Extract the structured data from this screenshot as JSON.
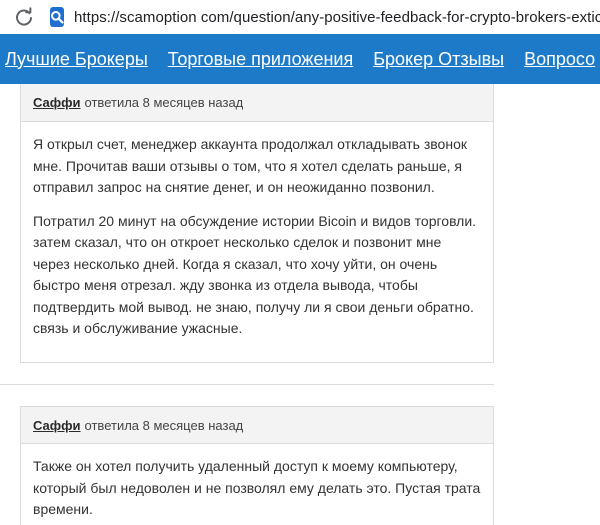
{
  "browser": {
    "url": "https://scamoption com/question/any-positive-feedback-for-crypto-brokers-extick/"
  },
  "nav": {
    "items": [
      {
        "label": "Лучшие Брокеры"
      },
      {
        "label": "Торговые приложения"
      },
      {
        "label": "Брокер Отзывы"
      },
      {
        "label": "Вопросо"
      }
    ]
  },
  "answers": [
    {
      "author": "Саффи",
      "meta": "ответила 8 месяцев назад",
      "paragraphs": [
        "Я открыл счет, менеджер аккаунта продолжал откладывать звонок мне. Прочитав ваши отзывы о том, что я хотел сделать раньше, я отправил запрос на снятие денег, и он неожиданно позвонил.",
        "Потратил 20 минут на обсуждение истории Bicoin и видов торговли. затем сказал, что он откроет несколько сделок и позвонит мне через несколько дней. Когда я сказал, что хочу уйти, он очень быстро меня отрезал. жду звонка из отдела вывода, чтобы подтвердить мой вывод. не знаю, получу ли я свои деньги обратно. связь и обслуживание ужасные."
      ]
    },
    {
      "author": "Саффи",
      "meta": "ответила 8 месяцев назад",
      "paragraphs": [
        "Также он хотел получить удаленный доступ к моему компьютеру, который был недоволен и не позволял ему делать это. Пустая трата времени."
      ]
    }
  ],
  "colors": {
    "nav_bg": "#1d7ac9",
    "site_icon_bg": "#1f6fd1"
  }
}
